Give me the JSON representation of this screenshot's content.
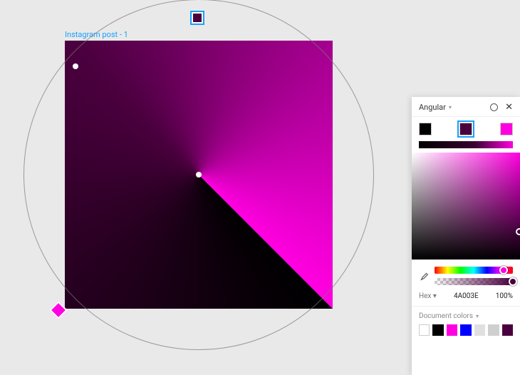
{
  "artboard": {
    "label": "Instagram post - 1"
  },
  "panel": {
    "title": "Angular",
    "gradient_stops": [
      {
        "color": "#000000",
        "selected": false
      },
      {
        "color": "#4A003E",
        "selected": true
      },
      {
        "color": "#FF00E0",
        "selected": false
      }
    ],
    "hue_thumb_pct": 88,
    "alpha_thumb_pct": 100,
    "hex": {
      "mode_label": "Hex",
      "value": "4A003E",
      "opacity": "100%"
    },
    "doc_colors": {
      "title": "Document colors",
      "swatches": [
        {
          "color": "#FFFFFF",
          "outline": true
        },
        {
          "color": "#000000"
        },
        {
          "color": "#FF00E0"
        },
        {
          "color": "#0000FF"
        },
        {
          "color": "#E0E0E0"
        },
        {
          "color": "#CFCFCF"
        },
        {
          "color": "#4A003E"
        }
      ]
    }
  }
}
